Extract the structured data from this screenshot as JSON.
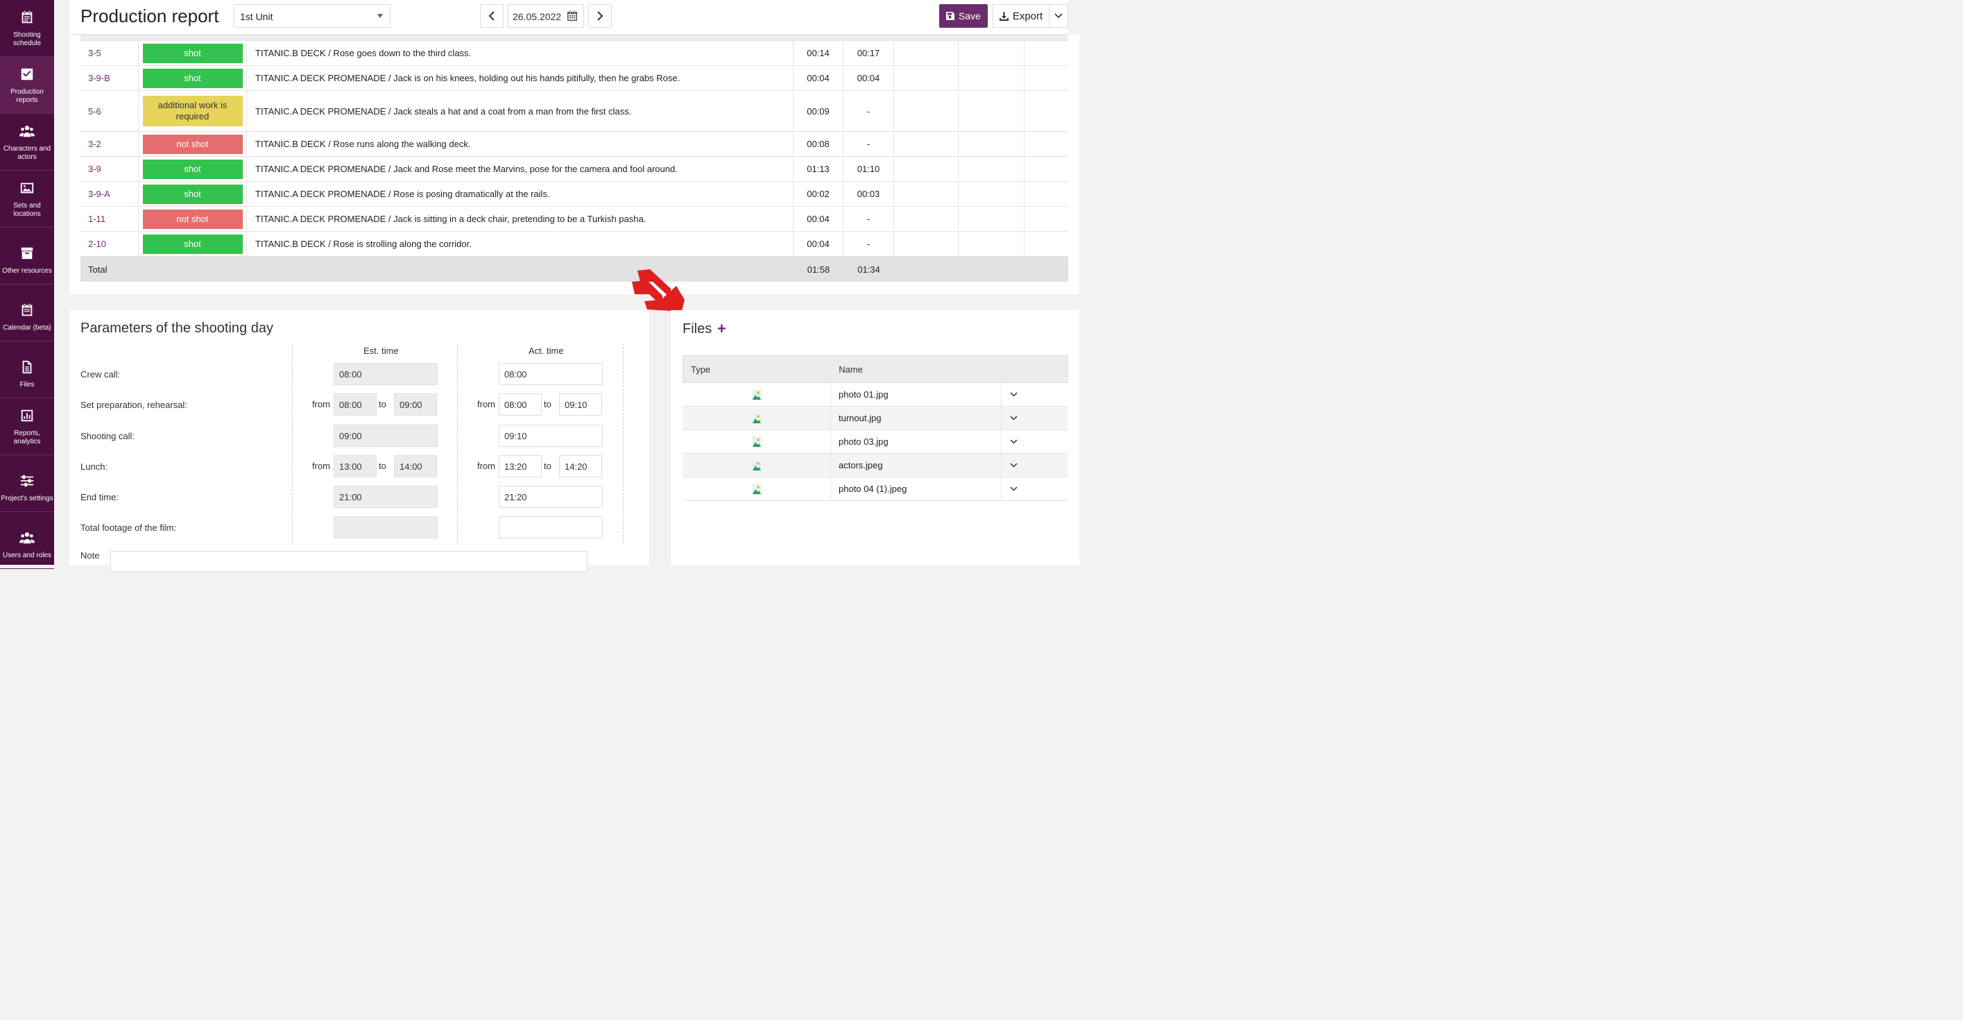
{
  "sidebar": {
    "items": [
      {
        "label": "Shooting schedule",
        "icon": "calendar-grid-icon"
      },
      {
        "label": "Production reports",
        "icon": "checkbox-icon"
      },
      {
        "label": "Characters and actors",
        "icon": "people-icon"
      },
      {
        "label": "Sets and locations",
        "icon": "image-icon"
      },
      {
        "label": "Other resources",
        "icon": "archive-icon"
      },
      {
        "label": "Calendar (beta)",
        "icon": "calendar-icon"
      },
      {
        "label": "Files",
        "icon": "file-icon"
      },
      {
        "label": "Reports, analytics",
        "icon": "bar-chart-icon"
      },
      {
        "label": "Project's settings",
        "icon": "sliders-icon"
      },
      {
        "label": "Users and roles",
        "icon": "users-icon"
      }
    ]
  },
  "header": {
    "title": "Production report",
    "unit": "1st Unit",
    "date": "26.05.2022",
    "save_label": "Save",
    "export_label": "Export"
  },
  "status_colors": {
    "shot": "#33c24d",
    "not shot": "#e56d6d",
    "additional work is required": "#e6d45a"
  },
  "scenes": [
    {
      "num": "3-5",
      "status": "shot",
      "desc": "TITANIC.B DECK / Rose goes down to the third class.",
      "est": "00:14",
      "act": "00:17"
    },
    {
      "num": "3-9-B",
      "status": "shot",
      "desc": "TITANIC.A DECK PROMENADE / Jack is on his knees, holding out his hands pitifully, then he grabs Rose.",
      "est": "00:04",
      "act": "00:04"
    },
    {
      "num": "5-6",
      "status": "additional work is required",
      "desc": "TITANIC.A DECK PROMENADE / Jack steals a hat and a coat from a man from the first class.",
      "est": "00:09",
      "act": "-"
    },
    {
      "num": "3-2",
      "status": "not shot",
      "desc": "TITANIC.B DECK / Rose runs along the walking deck.",
      "est": "00:08",
      "act": "-"
    },
    {
      "num": "3-9",
      "status": "shot",
      "desc": "TITANIC.A DECK PROMENADE / Jack and Rose meet the Marvins, pose for the camera and fool around.",
      "est": "01:13",
      "act": "01:10"
    },
    {
      "num": "3-9-A",
      "status": "shot",
      "desc": "TITANIC.A DECK PROMENADE / Rose is posing dramatically at the rails.",
      "est": "00:02",
      "act": "00:03"
    },
    {
      "num": "1-11",
      "status": "not shot",
      "desc": "TITANIC.A DECK PROMENADE / Jack is sitting in a deck chair, pretending to be a Turkish pasha.",
      "est": "00:04",
      "act": "-"
    },
    {
      "num": "2-10",
      "status": "shot",
      "desc": "TITANIC.B DECK / Rose is strolling along the corridor.",
      "est": "00:04",
      "act": "-"
    }
  ],
  "total": {
    "label": "Total",
    "est": "01:58",
    "act": "01:34"
  },
  "params": {
    "title": "Parameters of the shooting day",
    "est_header": "Est. time",
    "act_header": "Act. time",
    "from": "from",
    "to": "to",
    "crew_call": {
      "label": "Crew call:",
      "est": "08:00",
      "act": "08:00"
    },
    "set_prep": {
      "label": "Set preparation, rehearsal:",
      "est_from": "08:00",
      "est_to": "09:00",
      "act_from": "08:00",
      "act_to": "09:10"
    },
    "shooting_call": {
      "label": "Shooting call:",
      "est": "09:00",
      "act": "09:10"
    },
    "lunch": {
      "label": "Lunch:",
      "est_from": "13:00",
      "est_to": "14:00",
      "act_from": "13:20",
      "act_to": "14:20"
    },
    "end_time": {
      "label": "End time:",
      "est": "21:00",
      "act": "21:20"
    },
    "footage": {
      "label": "Total footage of the film:",
      "est": "",
      "act": ""
    },
    "note_label": "Note"
  },
  "files": {
    "title": "Files",
    "add": "+",
    "col_type": "Type",
    "col_name": "Name",
    "items": [
      "photo 01.jpg",
      "turnout.jpg",
      "photo 03.jpg",
      "actors.jpeg",
      "photo 04 (1).jpeg"
    ]
  }
}
